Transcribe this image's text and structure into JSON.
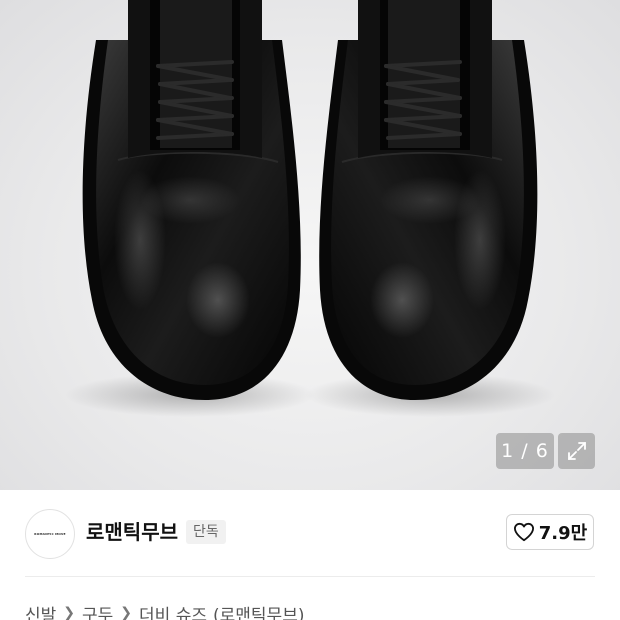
{
  "gallery": {
    "image_alt": "black leather derby shoes",
    "counter": "1 / 6",
    "expand_icon": "expand-icon"
  },
  "brand": {
    "logo_text": "ROMANTIC MOVE",
    "name": "로맨틱무브",
    "badge": "단독",
    "like_icon": "heart-icon",
    "like_count": "7.9만"
  },
  "breadcrumb": {
    "items": [
      "신발",
      "구두",
      "더비 슈즈",
      "(로맨틱무브)"
    ],
    "separator_icon": "chevron-right-icon"
  }
}
